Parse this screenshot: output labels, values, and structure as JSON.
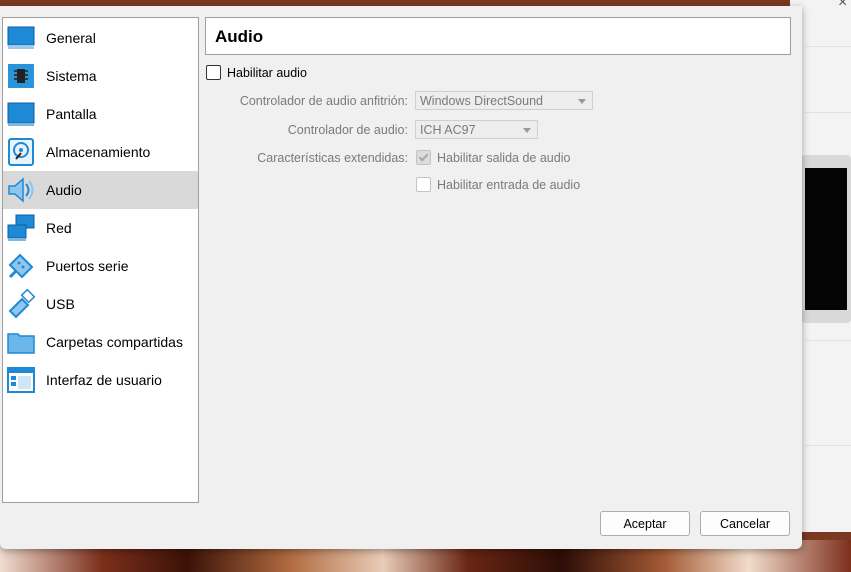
{
  "sidebar": {
    "items": [
      {
        "label": "General",
        "icon": "general-monitor-icon"
      },
      {
        "label": "Sistema",
        "icon": "chip-icon"
      },
      {
        "label": "Pantalla",
        "icon": "display-icon"
      },
      {
        "label": "Almacenamiento",
        "icon": "storage-disk-icon"
      },
      {
        "label": "Audio",
        "icon": "speaker-icon",
        "selected": true
      },
      {
        "label": "Red",
        "icon": "network-icon"
      },
      {
        "label": "Puertos serie",
        "icon": "serial-port-icon"
      },
      {
        "label": "USB",
        "icon": "usb-icon"
      },
      {
        "label": "Carpetas compartidas",
        "icon": "folder-icon"
      },
      {
        "label": "Interfaz de usuario",
        "icon": "user-interface-icon"
      }
    ]
  },
  "page": {
    "title": "Audio",
    "enable_audio": {
      "label": "Habilitar audio",
      "checked": false
    },
    "host_driver": {
      "label": "Controlador de audio anfitrión:",
      "value": "Windows DirectSound"
    },
    "controller": {
      "label": "Controlador de audio:",
      "value": "ICH AC97"
    },
    "extended": {
      "label": "Características extendidas:",
      "output": {
        "label": "Habilitar salida de audio",
        "checked": true
      },
      "input": {
        "label": "Habilitar entrada de audio",
        "checked": false
      }
    }
  },
  "buttons": {
    "ok": "Aceptar",
    "cancel": "Cancelar"
  },
  "colors": {
    "accent": "#1e8ad6",
    "selected_bg": "#d9d9d9",
    "dialog_bg": "#f0f0f0"
  }
}
